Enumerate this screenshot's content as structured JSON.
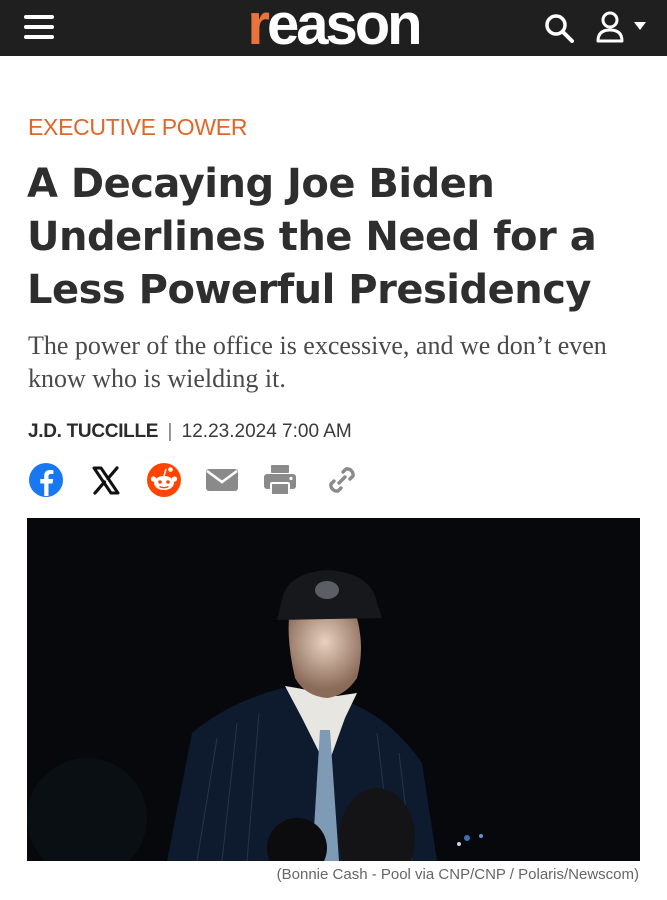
{
  "header": {
    "logo_first": "r",
    "logo_rest": "eason",
    "menu_icon": "hamburger-menu-icon",
    "search_icon": "search-icon",
    "account_icon": "user-icon",
    "brand_color": "#e8743b"
  },
  "article": {
    "section": "EXECUTIVE POWER",
    "headline": "A Decaying Joe Biden Underlines the Need for a Less Powerful Presidency",
    "dek": "The power of the office is excessive, and we don’t even know who is wielding it.",
    "author": "J.D. TUCCILLE",
    "separator": "|",
    "date": "12.23.2024 7:00 AM"
  },
  "share": {
    "icons": [
      "facebook-icon",
      "x-icon",
      "reddit-icon",
      "email-icon",
      "print-icon",
      "link-icon"
    ]
  },
  "photo": {
    "caption": "(Bonnie Cash - Pool via CNP/CNP / Polaris/Newscom)"
  }
}
